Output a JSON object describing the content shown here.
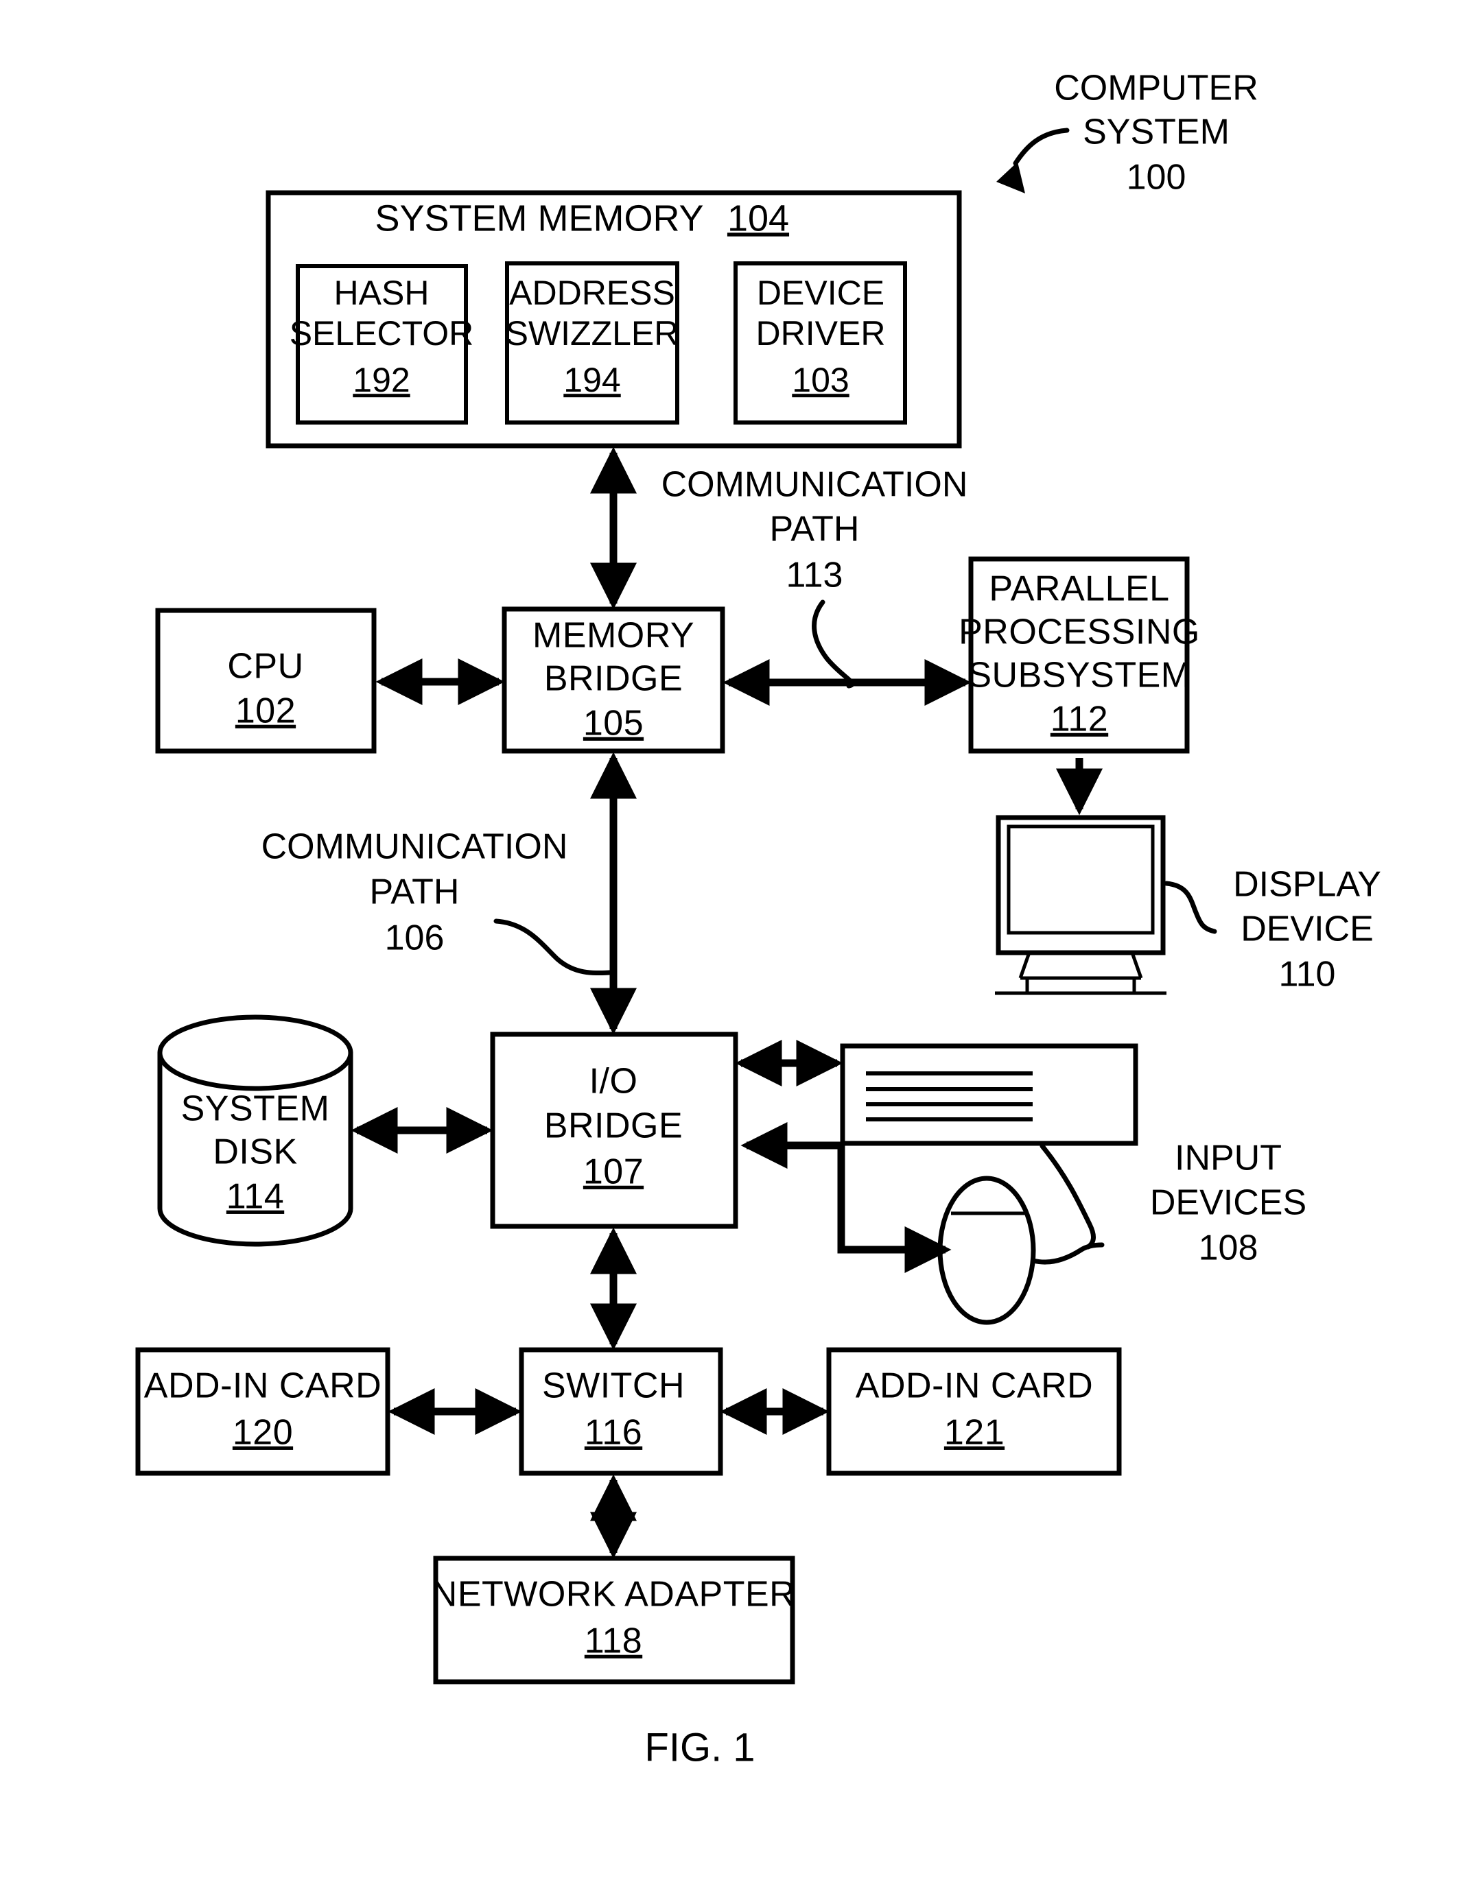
{
  "figure": {
    "caption": "FIG. 1",
    "system_label_line1": "COMPUTER",
    "system_label_line2": "SYSTEM",
    "system_label_ref": "100"
  },
  "system_memory": {
    "title": "SYSTEM MEMORY",
    "ref": "104",
    "modules": [
      {
        "name": "hash-selector",
        "line1": "HASH",
        "line2": "SELECTOR",
        "ref": "192"
      },
      {
        "name": "address-swizzler",
        "line1": "ADDRESS",
        "line2": "SWIZZLER",
        "ref": "194"
      },
      {
        "name": "device-driver",
        "line1": "DEVICE",
        "line2": "DRIVER",
        "ref": "103"
      }
    ]
  },
  "blocks": {
    "cpu": {
      "line1": "CPU",
      "line2": "",
      "ref": "102"
    },
    "memory_bridge": {
      "line1": "MEMORY",
      "line2": "BRIDGE",
      "ref": "105"
    },
    "parallel_subsys": {
      "line1": "PARALLEL",
      "line2": "PROCESSING",
      "line3": "SUBSYSTEM",
      "ref": "112"
    },
    "io_bridge": {
      "line1": "I/O",
      "line2": "BRIDGE",
      "ref": "107"
    },
    "system_disk": {
      "line1": "SYSTEM",
      "line2": "DISK",
      "ref": "114"
    },
    "switch": {
      "line1": "SWITCH",
      "line2": "",
      "ref": "116"
    },
    "add_in_card_left": {
      "line1": "ADD-IN CARD",
      "line2": "",
      "ref": "120"
    },
    "add_in_card_right": {
      "line1": "ADD-IN CARD",
      "line2": "",
      "ref": "121"
    },
    "network_adapter": {
      "line1": "NETWORK ADAPTER",
      "line2": "",
      "ref": "118"
    }
  },
  "annotations": {
    "comm_path_113": {
      "line1": "COMMUNICATION",
      "line2": "PATH",
      "ref": "113"
    },
    "comm_path_106": {
      "line1": "COMMUNICATION",
      "line2": "PATH",
      "ref": "106"
    },
    "display_device": {
      "line1": "DISPLAY",
      "line2": "DEVICE",
      "ref": "110"
    },
    "input_devices": {
      "line1": "INPUT",
      "line2": "DEVICES",
      "ref": "108"
    }
  },
  "colors": {
    "stroke": "#000000",
    "background": "#ffffff"
  }
}
